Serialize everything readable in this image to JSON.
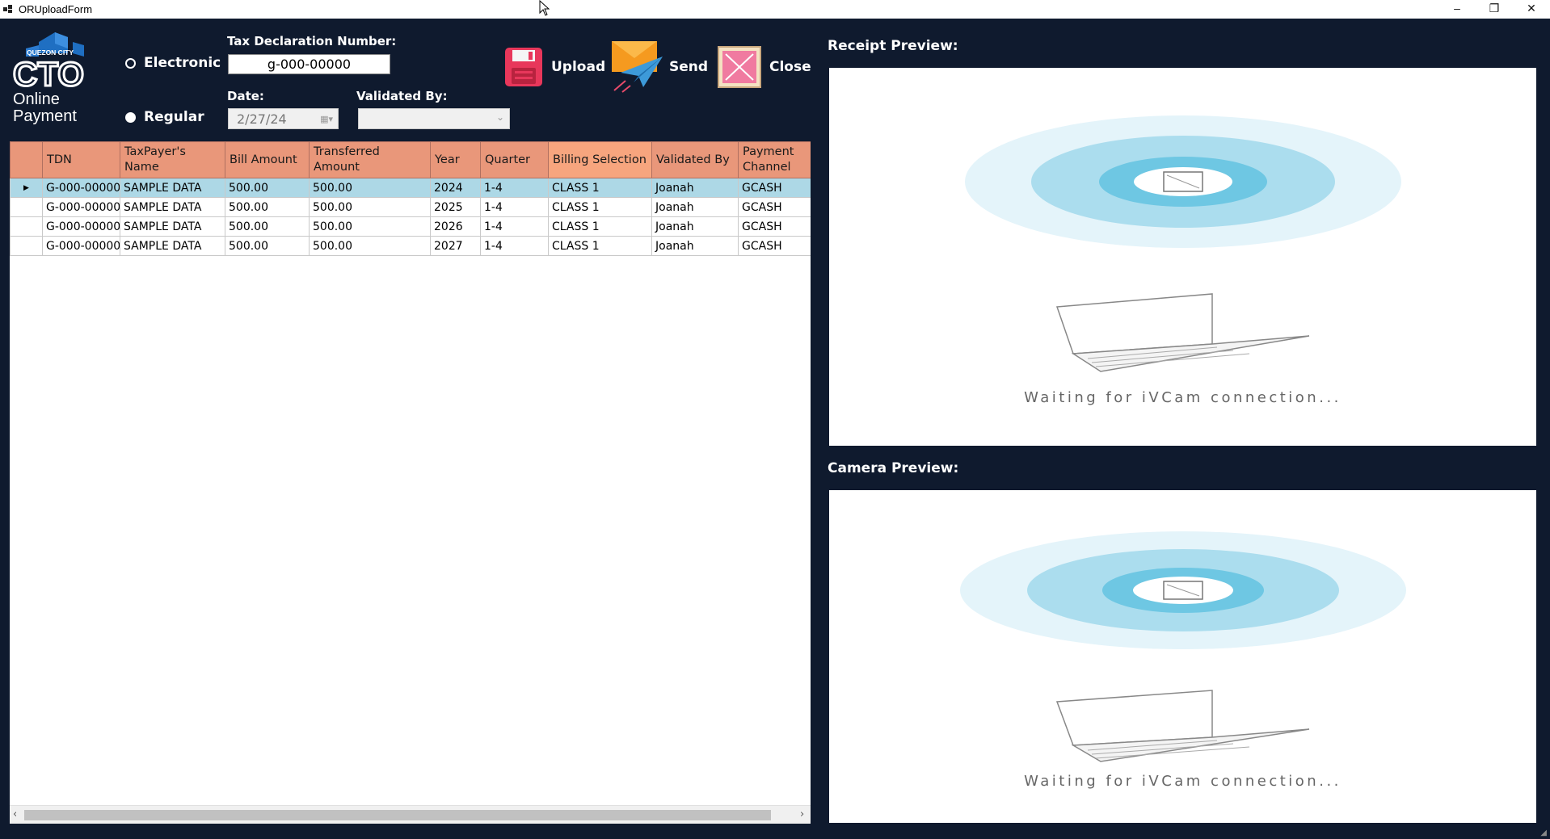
{
  "window": {
    "title": "ORUploadForm",
    "minimize": "–",
    "restore": "❐",
    "close": "✕"
  },
  "logo": {
    "city": "QUEZON CITY",
    "acronym": "CTO",
    "line1": "Online",
    "line2": "Payment"
  },
  "payment_type": {
    "options": [
      {
        "label": "Electronic",
        "selected": false
      },
      {
        "label": "Regular",
        "selected": true
      }
    ]
  },
  "form": {
    "tdn_label": "Tax Declaration Number:",
    "tdn_value": "g-000-00000",
    "date_label": "Date:",
    "date_value": "2/27/24",
    "validated_by_label": "Validated By:",
    "validated_by_value": ""
  },
  "toolbar": {
    "upload_label": "Upload",
    "send_label": "Send",
    "close_label": "Close"
  },
  "grid": {
    "columns": [
      "TDN",
      "TaxPayer's Name",
      "Bill Amount",
      "Transferred Amount",
      "Year",
      "Quarter",
      "Billing Selection",
      "Validated By",
      "Payment Channel"
    ],
    "rows": [
      {
        "tdn": "G-000-00000",
        "name": "SAMPLE DATA",
        "bill": "500.00",
        "transferred": "500.00",
        "year": "2024",
        "quarter": "1-4",
        "billing": "CLASS 1",
        "validated": "Joanah",
        "channel": "GCASH",
        "current": true
      },
      {
        "tdn": "G-000-00000",
        "name": "SAMPLE DATA",
        "bill": "500.00",
        "transferred": "500.00",
        "year": "2025",
        "quarter": "1-4",
        "billing": "CLASS 1",
        "validated": "Joanah",
        "channel": "GCASH",
        "current": false
      },
      {
        "tdn": "G-000-00000",
        "name": "SAMPLE DATA",
        "bill": "500.00",
        "transferred": "500.00",
        "year": "2026",
        "quarter": "1-4",
        "billing": "CLASS 1",
        "validated": "Joanah",
        "channel": "GCASH",
        "current": false
      },
      {
        "tdn": "G-000-00000",
        "name": "SAMPLE DATA",
        "bill": "500.00",
        "transferred": "500.00",
        "year": "2027",
        "quarter": "1-4",
        "billing": "CLASS 1",
        "validated": "Joanah",
        "channel": "GCASH",
        "current": false
      }
    ]
  },
  "receipt_preview": {
    "label": "Receipt Preview:",
    "status": "Waiting for iVCam connection..."
  },
  "camera_preview": {
    "label": "Camera Preview:",
    "status": "Waiting for iVCam connection..."
  },
  "colors": {
    "background": "#0f1a2e",
    "header": "#e9977a",
    "selected_row": "#add8e6"
  },
  "icons": {
    "upload": "floppy-disk-icon",
    "send": "mail-paper-plane-icon",
    "close": "close-box-icon"
  }
}
